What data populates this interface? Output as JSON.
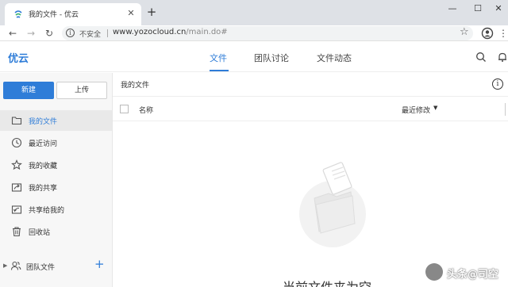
{
  "browser": {
    "tab_title": "我的文件 - 优云",
    "tab_close": "✕",
    "new_tab": "+",
    "window_controls": {
      "minimize": "—",
      "maximize": "☐",
      "close": "✕"
    },
    "nav": {
      "back": "←",
      "forward": "→",
      "reload": "↻"
    },
    "security_label": "不安全",
    "url_host": "www.yozocloud.cn",
    "url_path": "/main.do#"
  },
  "app": {
    "logo": "优云",
    "top_nav": [
      "文件",
      "团队讨论",
      "文件动态"
    ],
    "active_nav": "文件",
    "accent_color": "#2f7dd8"
  },
  "sidebar": {
    "new_button": "新建",
    "upload_button": "上传",
    "items": [
      {
        "label": "我的文件",
        "icon": "folder-icon",
        "active": true
      },
      {
        "label": "最近访问",
        "icon": "clock-icon",
        "active": false
      },
      {
        "label": "我的收藏",
        "icon": "star-icon",
        "active": false
      },
      {
        "label": "我的共享",
        "icon": "share-icon",
        "active": false
      },
      {
        "label": "共享给我的",
        "icon": "shared-with-me-icon",
        "active": false
      },
      {
        "label": "回收站",
        "icon": "trash-icon",
        "active": false
      }
    ],
    "team": {
      "label": "团队文件",
      "add": "+"
    }
  },
  "main": {
    "breadcrumb": "我的文件",
    "table_headers": {
      "name": "名称",
      "modified": "最近修改"
    },
    "empty_text": "当前文件夹为空"
  },
  "watermark": "头条@司空"
}
